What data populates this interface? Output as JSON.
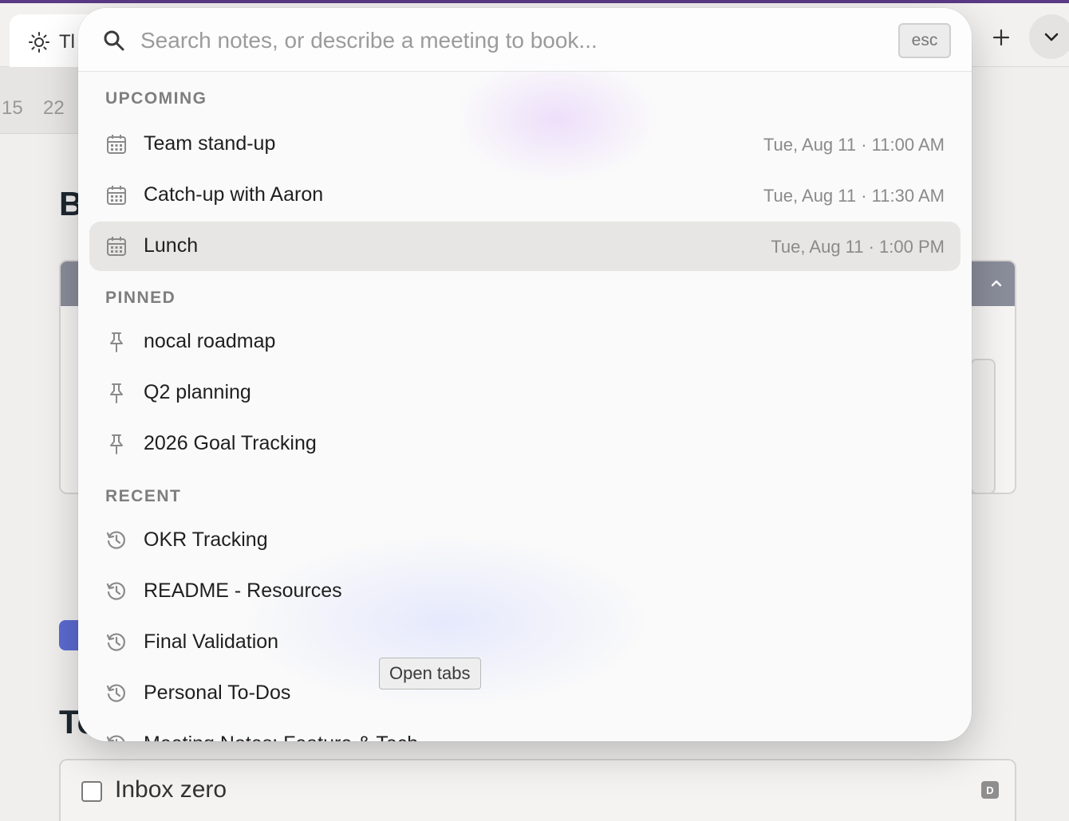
{
  "tabbar": {
    "active_tab": {
      "icon": "sun-icon",
      "label": "Tl"
    },
    "new_tab_icon": "plus-icon",
    "menu_icon": "chevron-down-icon"
  },
  "background": {
    "dates": [
      "15",
      "22"
    ],
    "heading_1": "B",
    "heading_2": "To",
    "todo": {
      "text": "Inbox zero",
      "badge": "D",
      "checked": false
    }
  },
  "palette": {
    "search": {
      "placeholder": "Search notes, or describe a meeting to book...",
      "value": ""
    },
    "esc_label": "esc",
    "sections": {
      "upcoming": {
        "label": "UPCOMING",
        "items": [
          {
            "icon": "calendar-icon",
            "label": "Team stand-up",
            "time": "Tue, Aug 11 · 11:00 AM"
          },
          {
            "icon": "calendar-icon",
            "label": "Catch-up with Aaron",
            "time": "Tue, Aug 11 · 11:30 AM"
          },
          {
            "icon": "calendar-icon",
            "label": "Lunch",
            "time": "Tue, Aug 11 · 1:00 PM",
            "selected": true
          }
        ]
      },
      "pinned": {
        "label": "PINNED",
        "items": [
          {
            "icon": "pin-icon",
            "label": "nocal roadmap"
          },
          {
            "icon": "pin-icon",
            "label": "Q2 planning"
          },
          {
            "icon": "pin-icon",
            "label": "2026 Goal Tracking"
          }
        ]
      },
      "recent": {
        "label": "RECENT",
        "items": [
          {
            "icon": "history-icon",
            "label": "OKR Tracking"
          },
          {
            "icon": "history-icon",
            "label": "README - Resources"
          },
          {
            "icon": "history-icon",
            "label": "Final Validation"
          },
          {
            "icon": "history-icon",
            "label": "Personal To-Dos"
          },
          {
            "icon": "history-icon",
            "label": "Meeting Notes: Feature & Tech"
          }
        ]
      }
    },
    "tooltip": "Open tabs"
  },
  "colors": {
    "accent": "#5b3a86",
    "selected_row": "#e7e6e4",
    "doc_blue": "#5b6bd0"
  }
}
